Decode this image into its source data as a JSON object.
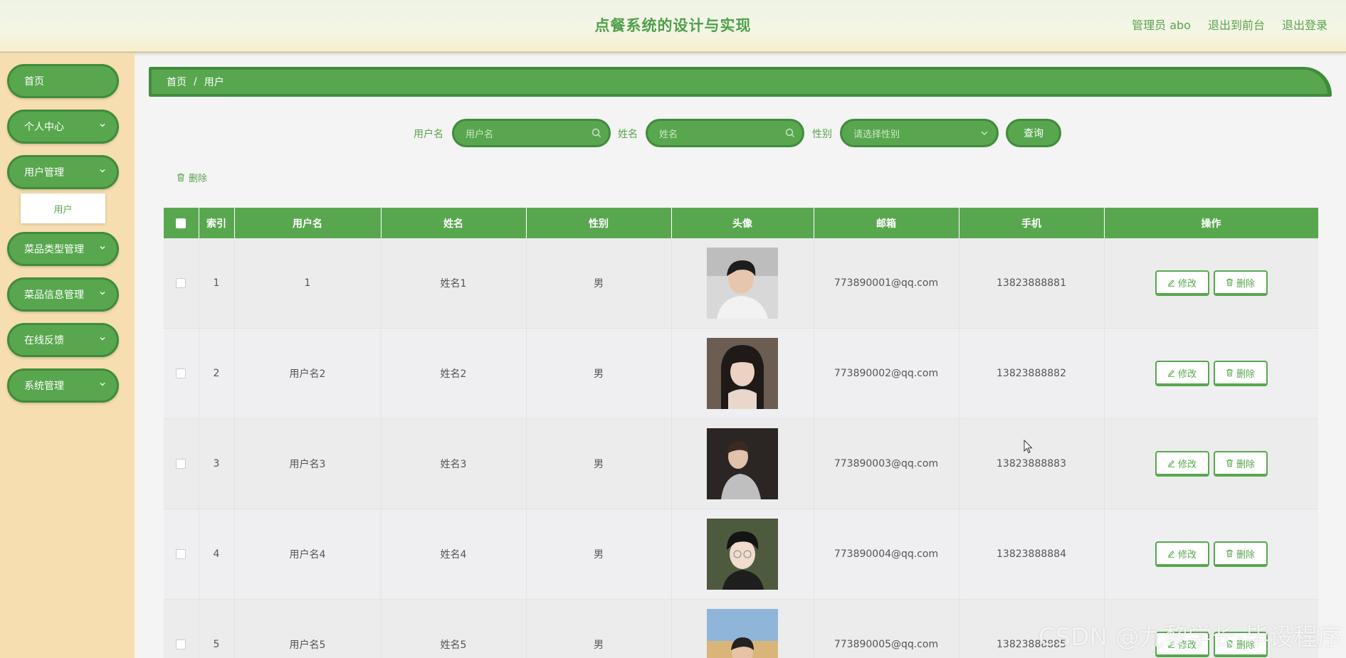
{
  "header": {
    "title": "点餐系统的设计与实现",
    "admin_label": "管理员 abo",
    "front_link": "退出到前台",
    "logout_link": "退出登录"
  },
  "sidebar": {
    "items": [
      {
        "label": "首页",
        "has_chevron": false
      },
      {
        "label": "个人中心",
        "has_chevron": true
      },
      {
        "label": "用户管理",
        "has_chevron": true
      },
      {
        "label": "菜品类型管理",
        "has_chevron": true
      },
      {
        "label": "菜品信息管理",
        "has_chevron": true
      },
      {
        "label": "在线反馈",
        "has_chevron": true
      },
      {
        "label": "系统管理",
        "has_chevron": true
      }
    ],
    "active_sub": "用户"
  },
  "breadcrumb": {
    "home": "首页",
    "separator": "/",
    "current": "用户"
  },
  "search": {
    "username_label": "用户名",
    "username_placeholder": "用户名",
    "name_label": "姓名",
    "name_placeholder": "姓名",
    "gender_label": "性别",
    "gender_placeholder": "请选择性别",
    "query_button": "查询"
  },
  "batch_delete_label": "删除",
  "table": {
    "headers": [
      "",
      "索引",
      "用户名",
      "姓名",
      "性别",
      "头像",
      "邮箱",
      "手机",
      "操作"
    ],
    "edit_label": "修改",
    "delete_label": "删除",
    "rows": [
      {
        "index": "1",
        "username": "1",
        "name": "姓名1",
        "gender": "男",
        "email": "773890001@qq.com",
        "phone": "13823888881"
      },
      {
        "index": "2",
        "username": "用户名2",
        "name": "姓名2",
        "gender": "男",
        "email": "773890002@qq.com",
        "phone": "13823888882"
      },
      {
        "index": "3",
        "username": "用户名3",
        "name": "姓名3",
        "gender": "男",
        "email": "773890003@qq.com",
        "phone": "13823888883"
      },
      {
        "index": "4",
        "username": "用户名4",
        "name": "姓名4",
        "gender": "男",
        "email": "773890004@qq.com",
        "phone": "13823888884"
      },
      {
        "index": "5",
        "username": "用户名5",
        "name": "姓名5",
        "gender": "男",
        "email": "773890005@qq.com",
        "phone": "13823888885"
      }
    ]
  },
  "watermark": "CSDN @九黎学长-毕设程序",
  "colors": {
    "primary": "#58a74f",
    "primary_dark": "#3f8c3c",
    "sidebar_bg": "#f7deb0",
    "text_green": "#5aa34f"
  }
}
